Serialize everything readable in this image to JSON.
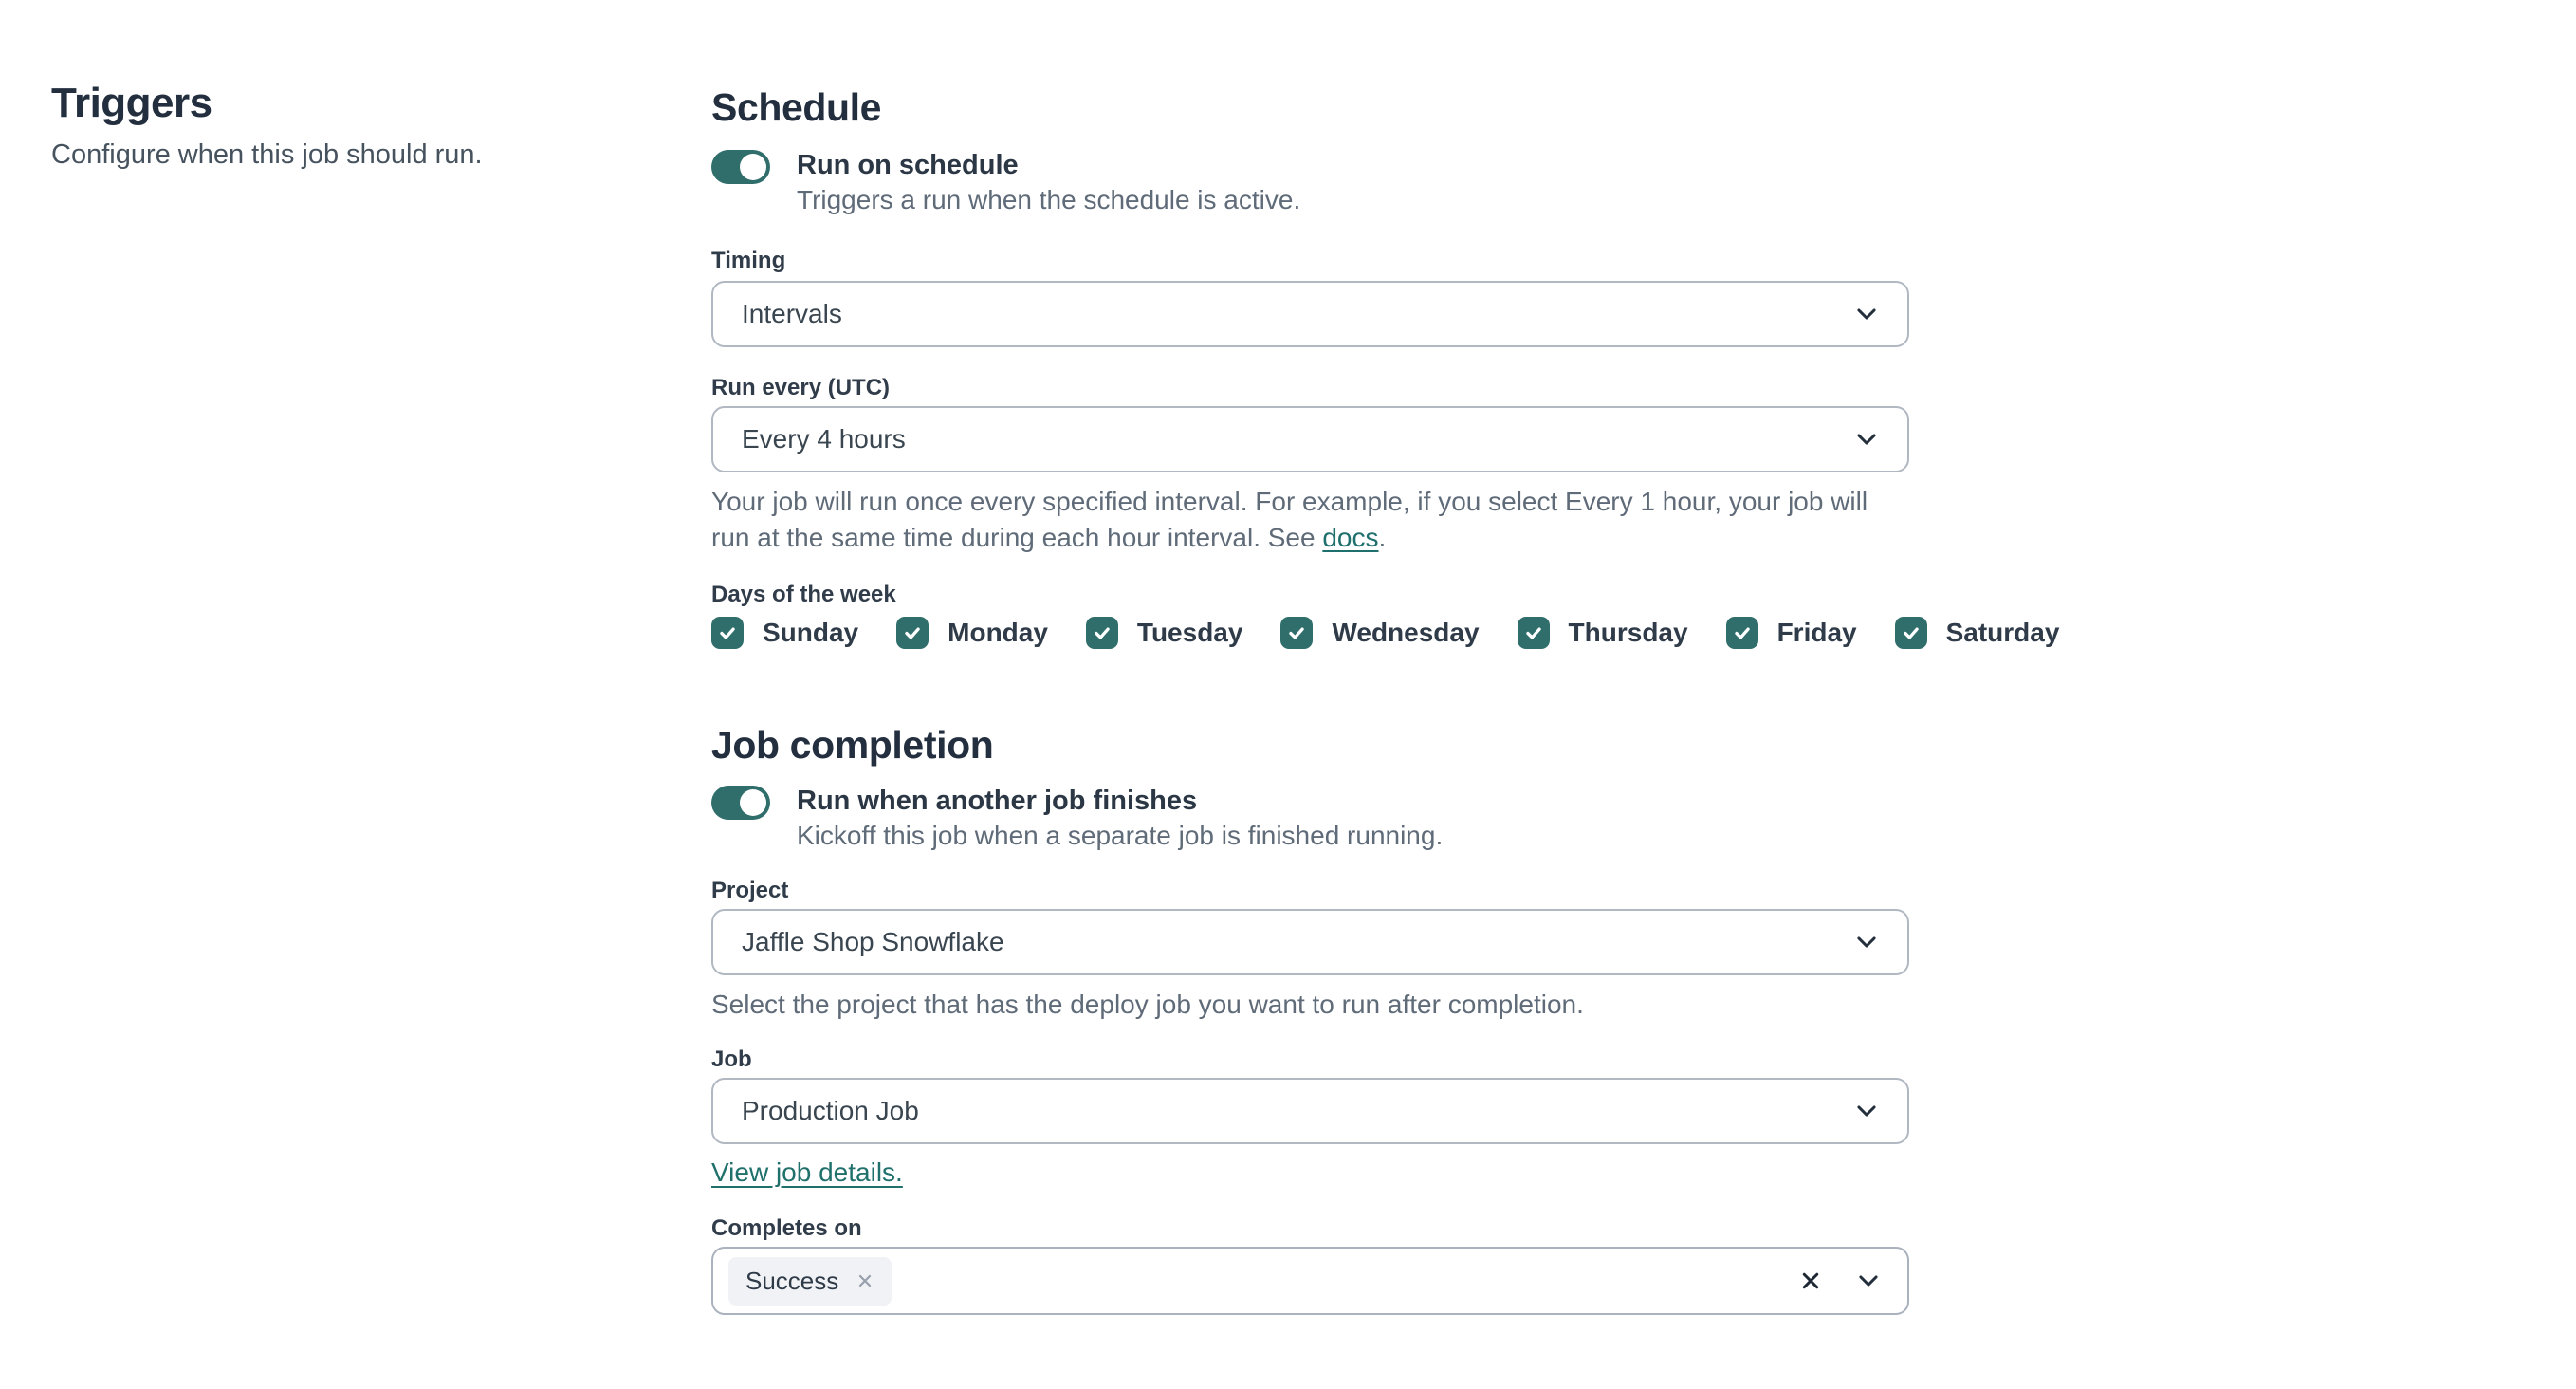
{
  "colors": {
    "accent_teal": "#2f6e6b",
    "link_teal": "#1f6f6d",
    "heading_navy": "#232f3f",
    "helper_gray": "#5f6b78",
    "border_gray": "#b1b8c2",
    "tag_background": "#f0f2f5"
  },
  "icons": {
    "toggle_on": "toggle-on",
    "checkbox_check": "✓",
    "chevron_down": "⌄",
    "clear": "✕",
    "tag_remove": "✕"
  },
  "left_panel": {
    "title": "Triggers",
    "subtitle": "Configure when this job should run."
  },
  "schedule": {
    "heading": "Schedule",
    "toggle": {
      "state": "on",
      "label": "Run on schedule",
      "description": "Triggers a run when the schedule is active."
    },
    "timing": {
      "label": "Timing",
      "value": "Intervals"
    },
    "run_every": {
      "label": "Run every (UTC)",
      "value": "Every 4 hours",
      "help_before_link": "Your job will run once every specified interval. For example, if you select Every 1 hour, your job will run at the same time during each hour interval. See ",
      "help_link": "docs",
      "help_after_link": "."
    },
    "days": {
      "label": "Days of the week",
      "items": [
        {
          "label": "Sunday",
          "checked": true
        },
        {
          "label": "Monday",
          "checked": true
        },
        {
          "label": "Tuesday",
          "checked": true
        },
        {
          "label": "Wednesday",
          "checked": true
        },
        {
          "label": "Thursday",
          "checked": true
        },
        {
          "label": "Friday",
          "checked": true
        },
        {
          "label": "Saturday",
          "checked": true
        }
      ]
    }
  },
  "job_completion": {
    "heading": "Job completion",
    "toggle": {
      "state": "on",
      "label": "Run when another job finishes",
      "description": "Kickoff this job when a separate job is finished running."
    },
    "project": {
      "label": "Project",
      "value": "Jaffle Shop Snowflake",
      "help": "Select the project that has the deploy job you want to run after completion."
    },
    "job": {
      "label": "Job",
      "value": "Production Job",
      "link": "View job details."
    },
    "completes_on": {
      "label": "Completes on",
      "tags": [
        {
          "label": "Success"
        }
      ]
    }
  }
}
